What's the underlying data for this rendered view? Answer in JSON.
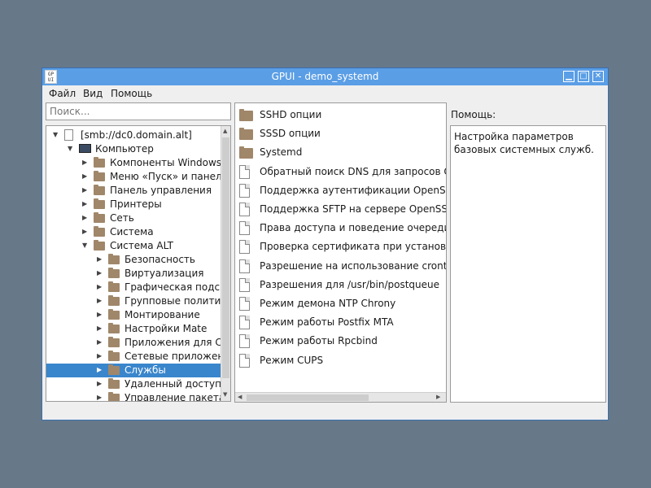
{
  "window": {
    "title": "GPUI - demo_systemd",
    "icon_text_1": "GP",
    "icon_text_2": "UI",
    "controls": [
      "▁",
      "□",
      "✕"
    ]
  },
  "menu": [
    "Файл",
    "Вид",
    "Помощь"
  ],
  "search": {
    "placeholder": "Поиск..."
  },
  "tree": {
    "items": [
      {
        "label": "[smb://dc0.domain.alt]",
        "arrow": "▼",
        "icon": "document-icon"
      },
      {
        "label": "Компьютер",
        "arrow": "▼",
        "icon": "computer-icon"
      },
      {
        "label": "Компоненты Windows",
        "arrow": "▶",
        "icon": "folder-icon"
      },
      {
        "label": "Меню «Пуск» и панель ...",
        "arrow": "▶",
        "icon": "folder-icon"
      },
      {
        "label": "Панель управления",
        "arrow": "▶",
        "icon": "folder-icon"
      },
      {
        "label": "Принтеры",
        "arrow": "▶",
        "icon": "folder-icon"
      },
      {
        "label": "Сеть",
        "arrow": "▶",
        "icon": "folder-icon"
      },
      {
        "label": "Система",
        "arrow": "▶",
        "icon": "folder-icon"
      },
      {
        "label": "Система ALT",
        "arrow": "▼",
        "icon": "folder-icon"
      },
      {
        "label": "Безопасность",
        "arrow": "▶",
        "icon": "folder-icon"
      },
      {
        "label": "Виртуализация",
        "arrow": "▶",
        "icon": "folder-icon"
      },
      {
        "label": "Графическая подсис...",
        "arrow": "▶",
        "icon": "folder-icon"
      },
      {
        "label": "Групповые политики",
        "arrow": "▶",
        "icon": "folder-icon"
      },
      {
        "label": "Монтирование",
        "arrow": "▶",
        "icon": "folder-icon"
      },
      {
        "label": "Настройки Mate",
        "arrow": "▶",
        "icon": "folder-icon"
      },
      {
        "label": "Приложения для CD...",
        "arrow": "▶",
        "icon": "folder-icon"
      },
      {
        "label": "Сетевые приложения",
        "arrow": "▶",
        "icon": "folder-icon"
      },
      {
        "label": "Службы",
        "arrow": "▶",
        "icon": "folder-icon",
        "selected": true
      },
      {
        "label": "Удаленный доступ ч...",
        "arrow": "▶",
        "icon": "folder-icon"
      },
      {
        "label": "Управление пакетами",
        "arrow": "▶",
        "icon": "folder-icon"
      }
    ]
  },
  "list": {
    "items": [
      {
        "label": "SSHD опции",
        "icon": "folder-icon"
      },
      {
        "label": "SSSD опции",
        "icon": "folder-icon"
      },
      {
        "label": "Systemd",
        "icon": "folder-icon"
      },
      {
        "label": "Обратный поиск DNS для запросов OpenLDAP",
        "icon": "document-icon"
      },
      {
        "label": "Поддержка аутентификации OpenSSH-клиента",
        "icon": "document-icon"
      },
      {
        "label": "Поддержка SFTP на сервере OpenSSH",
        "icon": "document-icon"
      },
      {
        "label": "Права доступа и поведение очереди заданий",
        "icon": "document-icon"
      },
      {
        "label": "Проверка сертификата при установлении соединения",
        "icon": "document-icon"
      },
      {
        "label": "Разрешение на использование crontab",
        "icon": "document-icon"
      },
      {
        "label": "Разрешения для /usr/bin/postqueue",
        "icon": "document-icon"
      },
      {
        "label": "Режим демона NTP Chrony",
        "icon": "document-icon"
      },
      {
        "label": "Режим работы Postfix MTA",
        "icon": "document-icon"
      },
      {
        "label": "Режим работы Rpcbind",
        "icon": "document-icon"
      },
      {
        "label": "Режим CUPS",
        "icon": "document-icon"
      }
    ]
  },
  "help": {
    "title": "Помощь:",
    "text": "Настройка параметров базовых системных служб."
  }
}
